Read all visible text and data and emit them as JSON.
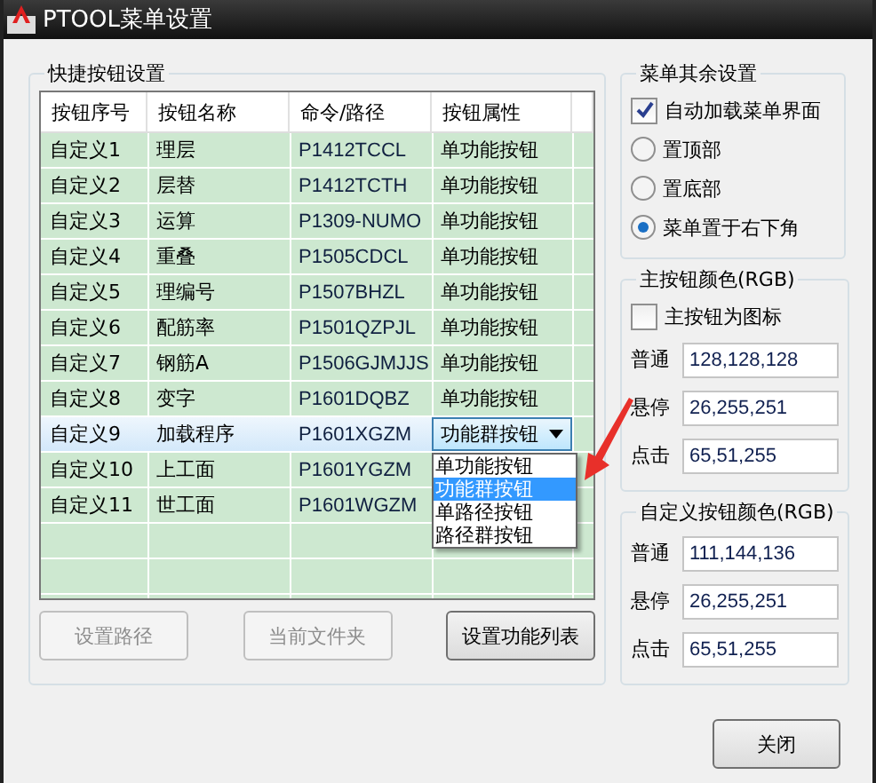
{
  "window": {
    "title": "PTOOL菜单设置"
  },
  "shortcut_group": {
    "title": "快捷按钮设置",
    "table": {
      "columns": [
        "按钮序号",
        "按钮名称",
        "命令/路径",
        "按钮属性"
      ],
      "rows": [
        {
          "index": "自定义1",
          "name": "理层",
          "command": "P1412TCCL",
          "attribute": "单功能按钮",
          "selected": false
        },
        {
          "index": "自定义2",
          "name": "层替",
          "command": "P1412TCTH",
          "attribute": "单功能按钮",
          "selected": false
        },
        {
          "index": "自定义3",
          "name": "运算",
          "command": "P1309-NUMO",
          "attribute": "单功能按钮",
          "selected": false
        },
        {
          "index": "自定义4",
          "name": "重叠",
          "command": "P1505CDCL",
          "attribute": "单功能按钮",
          "selected": false
        },
        {
          "index": "自定义5",
          "name": "理编号",
          "command": "P1507BHZL",
          "attribute": "单功能按钮",
          "selected": false
        },
        {
          "index": "自定义6",
          "name": "配筋率",
          "command": "P1501QZPJL",
          "attribute": "单功能按钮",
          "selected": false
        },
        {
          "index": "自定义7",
          "name": "钢筋A",
          "command": "P1506GJMJJS",
          "attribute": "单功能按钮",
          "selected": false
        },
        {
          "index": "自定义8",
          "name": "变字",
          "command": "P1601DQBZ",
          "attribute": "单功能按钮",
          "selected": false
        },
        {
          "index": "自定义9",
          "name": "加载程序",
          "command": "P1601XGZM",
          "attribute": "功能群按钮",
          "selected": true
        },
        {
          "index": "自定义10",
          "name": "上工面",
          "command": "P1601YGZM",
          "selected": false
        },
        {
          "index": "自定义11",
          "name": "世工面",
          "command": "P1601WGZM",
          "selected": false
        }
      ],
      "dropdown_options": [
        {
          "label": "单功能按钮",
          "selected": false
        },
        {
          "label": "功能群按钮",
          "selected": true
        },
        {
          "label": "单路径按钮",
          "selected": false
        },
        {
          "label": "路径群按钮",
          "selected": false
        }
      ]
    },
    "buttons": [
      {
        "label": "设置路径",
        "disabled": true
      },
      {
        "label": "当前文件夹",
        "disabled": true
      },
      {
        "label": "设置功能列表",
        "disabled": false
      }
    ]
  },
  "menu_group": {
    "title": "菜单其余设置",
    "auto_load": {
      "label": "自动加载菜单界面",
      "checked": true
    },
    "positions": [
      {
        "label": "置顶部",
        "selected": false
      },
      {
        "label": "置底部",
        "selected": false
      },
      {
        "label": "菜单置于右下角",
        "selected": true
      }
    ]
  },
  "main_color_group": {
    "title": "主按钮颜色(RGB)",
    "icon_option": {
      "label": "主按钮为图标",
      "checked": false
    },
    "fields": [
      {
        "label": "普通",
        "value": "128,128,128"
      },
      {
        "label": "悬停",
        "value": "26,255,251"
      },
      {
        "label": "点击",
        "value": "65,51,255"
      }
    ]
  },
  "custom_color_group": {
    "title": "自定义按钮颜色(RGB)",
    "fields": [
      {
        "label": "普通",
        "value": "111,144,136"
      },
      {
        "label": "悬停",
        "value": "26,255,251"
      },
      {
        "label": "点击",
        "value": "65,51,255"
      }
    ]
  },
  "close_button": {
    "label": "关闭"
  }
}
